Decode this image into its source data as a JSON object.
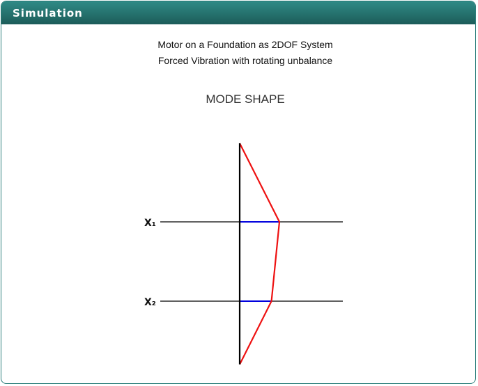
{
  "panel": {
    "title": "Simulation"
  },
  "simulation": {
    "title_line1": "Motor on a Foundation  as 2DOF System",
    "title_line2": "Forced Vibration with rotating unbalance",
    "diagram_label": "MODE SHAPE"
  },
  "mode_shape": {
    "mass_labels": [
      "X₁",
      "X₂"
    ],
    "displacements": [
      0.95,
      0.76
    ],
    "colors": {
      "axis": "#000000",
      "reference": "#000000",
      "amplitude": "#0000dd",
      "shape": "#ee1111",
      "header": "#25716d"
    }
  }
}
